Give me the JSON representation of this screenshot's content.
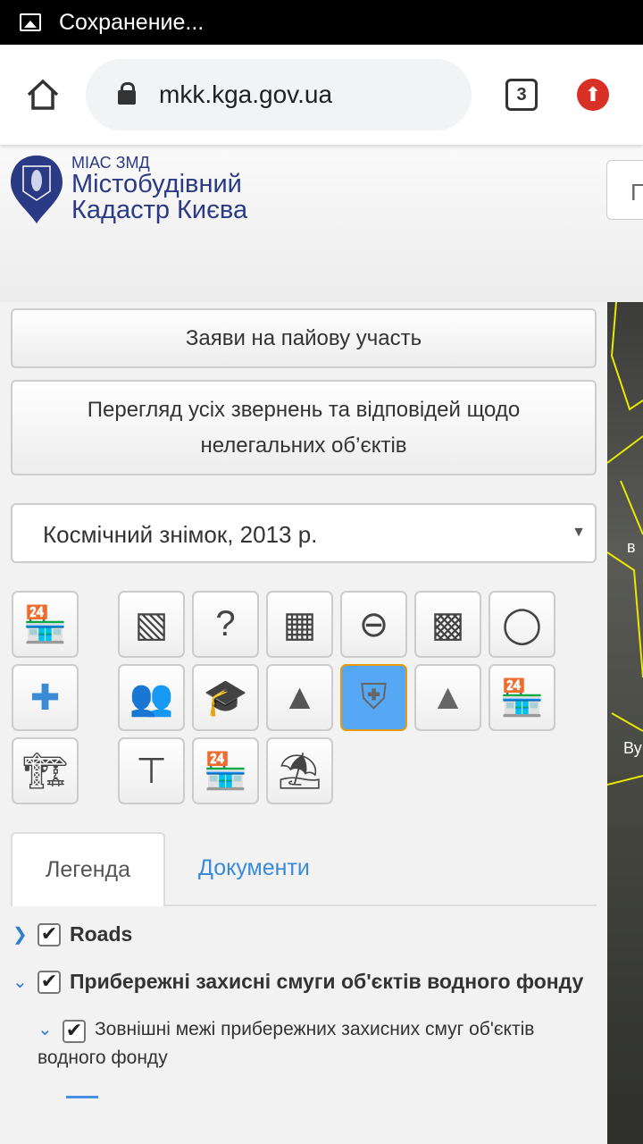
{
  "status_bar": {
    "text": "Сохранение..."
  },
  "browser": {
    "url": "mkk.kga.gov.ua",
    "tab_count": "3"
  },
  "header": {
    "logo_small": "МІАС ЗМД",
    "logo_line1": "Містобудівний",
    "logo_line2": "Кадастр Києва",
    "search_placeholder": "П"
  },
  "buttons": {
    "share": "Заяви на пайову участь",
    "illegal": "Перегляд усіх звернень та відповідей щодо нелегальних об’єктів"
  },
  "basemap_select": {
    "value": "Космічний знімок, 2013 р."
  },
  "layer_icons": [
    "shop-icon",
    "zoning-doc-icon",
    "unknown-plot-icon",
    "landuse-grid-icon",
    "restricted-zone-icon",
    "hatched-area-icon",
    "antlers-icon",
    "map-blue-icon",
    "people-icon",
    "education-icon",
    "monument-icon",
    "police-badge-icon",
    "tree-icon",
    "shop-icon",
    "construction-crane-icon",
    "billboard-icon",
    "shop-icon",
    "cafe-terrace-icon"
  ],
  "tabs": {
    "legend": "Легенда",
    "documents": "Документи"
  },
  "legend": {
    "roads": "Roads",
    "water_strips": "Прибережні захисні смуги об'єктів водного фонду",
    "outer_bounds": "Зовнішні межі прибережних захисних смуг об'єктів водного фонду"
  },
  "colors": {
    "accent": "#3a8ad6",
    "active_icon": "#56a8f5",
    "logo": "#2b3a84"
  }
}
